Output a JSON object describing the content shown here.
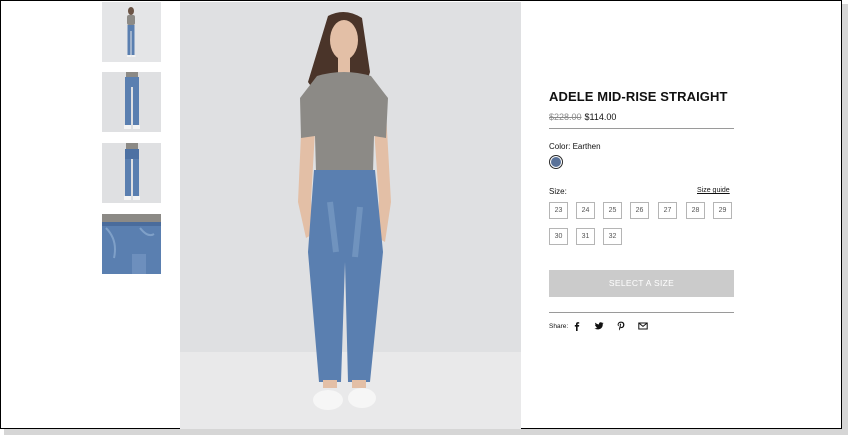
{
  "product": {
    "title": "ADELE MID-RISE STRAIGHT",
    "original_price": "$228.00",
    "sale_price": "$114.00",
    "color_label": "Color: Earthen",
    "swatch_color": "#5a7299",
    "size_label": "Size:",
    "size_guide": "Size guide",
    "sizes": [
      "23",
      "24",
      "25",
      "26",
      "27",
      "28",
      "29",
      "30",
      "31",
      "32"
    ],
    "cta": "SELECT A SIZE"
  },
  "share": {
    "label": "Share:",
    "icons": [
      "facebook-icon",
      "twitter-icon",
      "pinterest-icon",
      "email-icon"
    ]
  },
  "colors": {
    "denim": "#5a7fb0",
    "shirt": "#8c8a86",
    "button_disabled": "#cbcbcb"
  }
}
